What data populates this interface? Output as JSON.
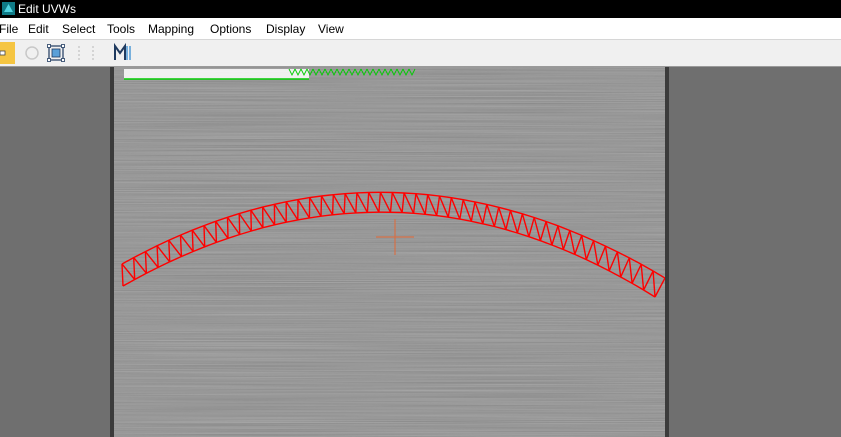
{
  "window": {
    "title": "Edit UVWs"
  },
  "menubar": {
    "items": [
      {
        "id": "file",
        "label": "File"
      },
      {
        "id": "edit",
        "label": "Edit"
      },
      {
        "id": "select",
        "label": "Select"
      },
      {
        "id": "tools",
        "label": "Tools"
      },
      {
        "id": "mapping",
        "label": "Mapping"
      },
      {
        "id": "options",
        "label": "Options"
      },
      {
        "id": "display",
        "label": "Display"
      },
      {
        "id": "view",
        "label": "View"
      }
    ]
  },
  "toolbar": {
    "tools": [
      {
        "id": "move",
        "icon": "move-icon",
        "active": true
      },
      {
        "id": "rotate",
        "icon": "rotate-icon",
        "active": false
      },
      {
        "id": "freeform",
        "icon": "freeform-icon",
        "active": false
      },
      {
        "id": "scale",
        "icon": "scale-icon",
        "active": false
      },
      {
        "id": "mirror",
        "icon": "mirror-icon",
        "active": false
      }
    ]
  },
  "viewport": {
    "background": "brushed-metal-texture",
    "uv_shells": [
      {
        "id": "arch",
        "color": "#ff0000",
        "state": "selected"
      },
      {
        "id": "strip",
        "color": "#00cc00",
        "state": "unselected"
      }
    ],
    "gizmo": {
      "icon": "crosshair-icon",
      "color": "#e06a3a"
    }
  },
  "colors": {
    "titlebar": "#000000",
    "menubar": "#ffffff",
    "toolbar": "#f0f0f0",
    "toolbar_active": "#f5c542",
    "side_panel": "#6f6f6f",
    "selected_uv": "#ff0000",
    "unselected_uv": "#00cc00"
  }
}
